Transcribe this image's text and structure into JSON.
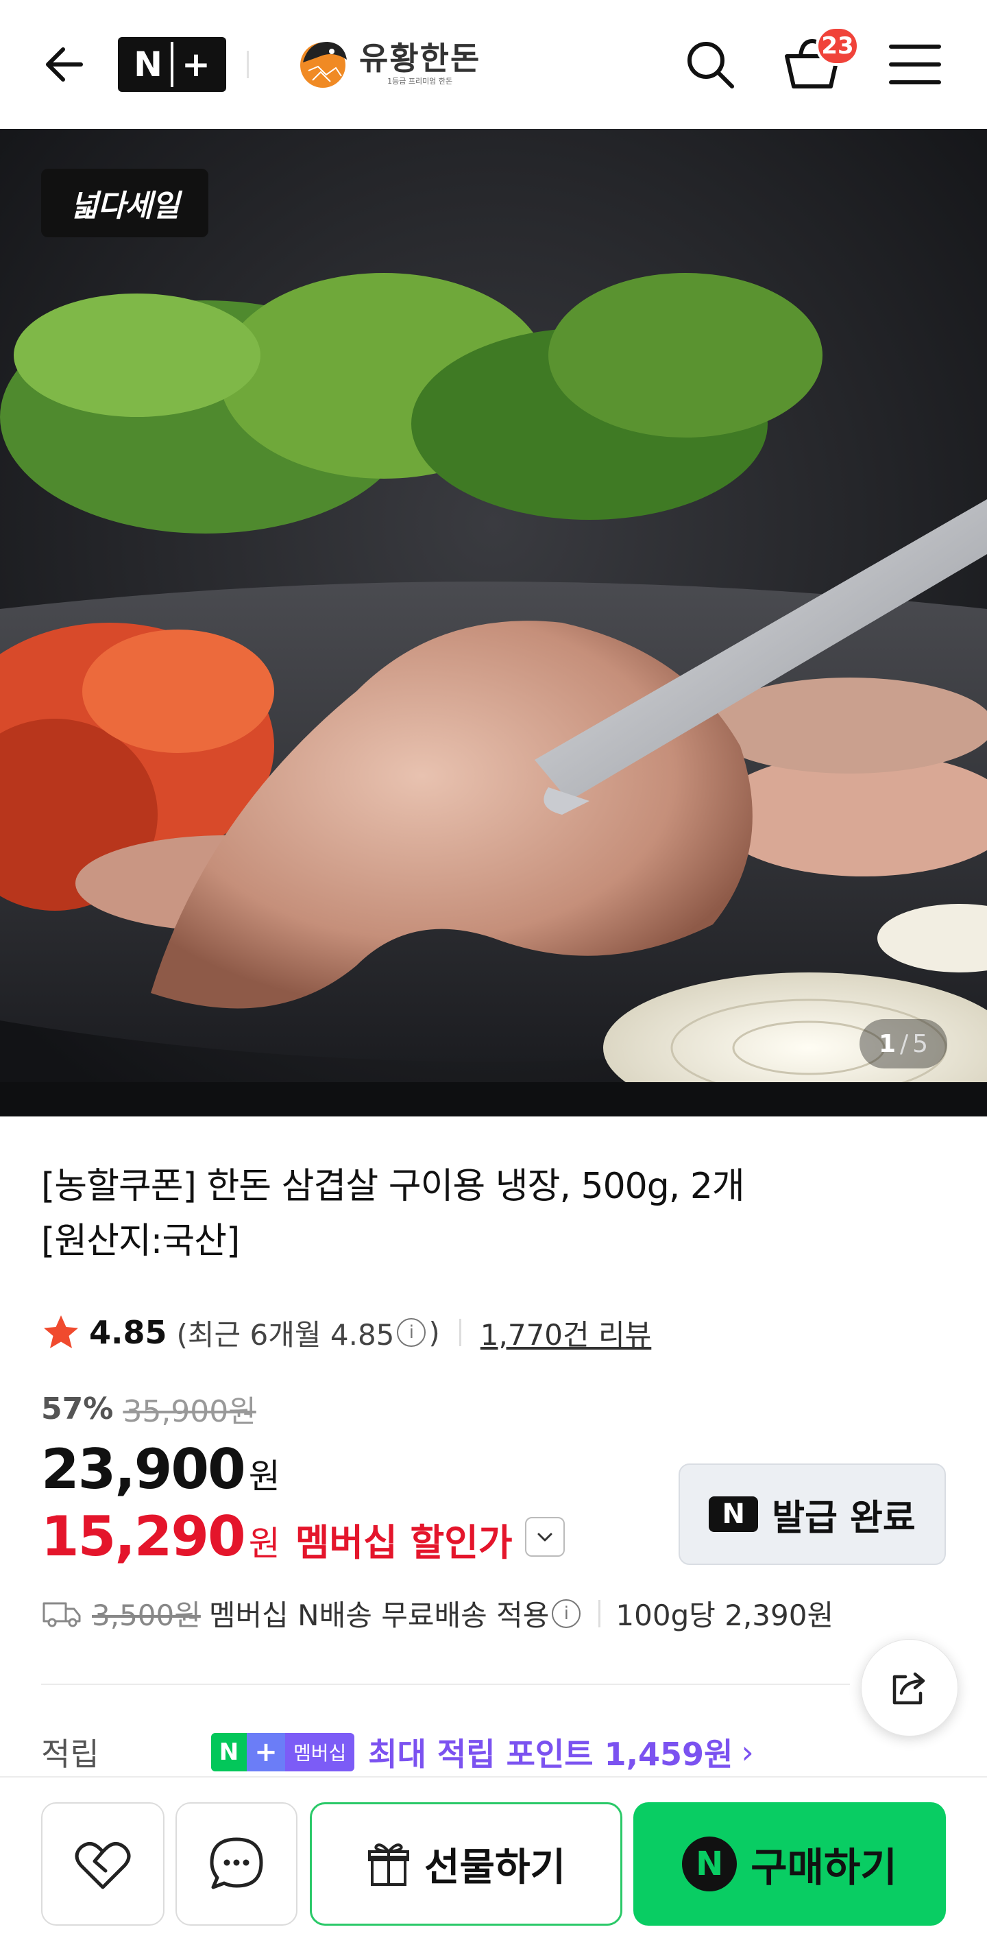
{
  "header": {
    "nplus_label": "N+",
    "brand_name": "유황한돈",
    "brand_sub": "1등급 프리미엄 한돈",
    "cart_count": "23"
  },
  "hero": {
    "badge": "넓다세일",
    "page_current": "1",
    "page_sep": "/",
    "page_total": "5"
  },
  "product": {
    "title_line1": "[농할쿠폰] 한돈 삼겹살 구이용 냉장, 500g, 2개",
    "title_line2": "[원산지:국산]",
    "rating": "4.85",
    "recent_prefix": "(최근 6개월 4.85",
    "recent_suffix": ")",
    "info_icon": "i",
    "reviews": "1,770건 리뷰",
    "discount_rate": "57%",
    "original_price": "35,900원",
    "price": "23,900",
    "price_unit": "원",
    "member_price": "15,290",
    "member_unit": "원",
    "member_label": "멤버십 할인가",
    "coupon_n": "N",
    "coupon_label": "발급 완료",
    "ship_original": "3,500원",
    "ship_text": "멤버십 N배송 무료배송 적용",
    "unit_price": "100g당 2,390원"
  },
  "points": {
    "label": "적립",
    "badge_n": "N",
    "badge_plus": "+",
    "badge_member": "멤버십",
    "text": "최대 적립 포인트 1,459원",
    "arrow": "›"
  },
  "bottom": {
    "gift_label": "선물하기",
    "buy_n": "N",
    "buy_label": "구매하기"
  },
  "colors": {
    "accent_green": "#09cd63",
    "sale_red": "#e4152b",
    "points_purple": "#7b52f0",
    "badge_red": "#f0433a"
  }
}
